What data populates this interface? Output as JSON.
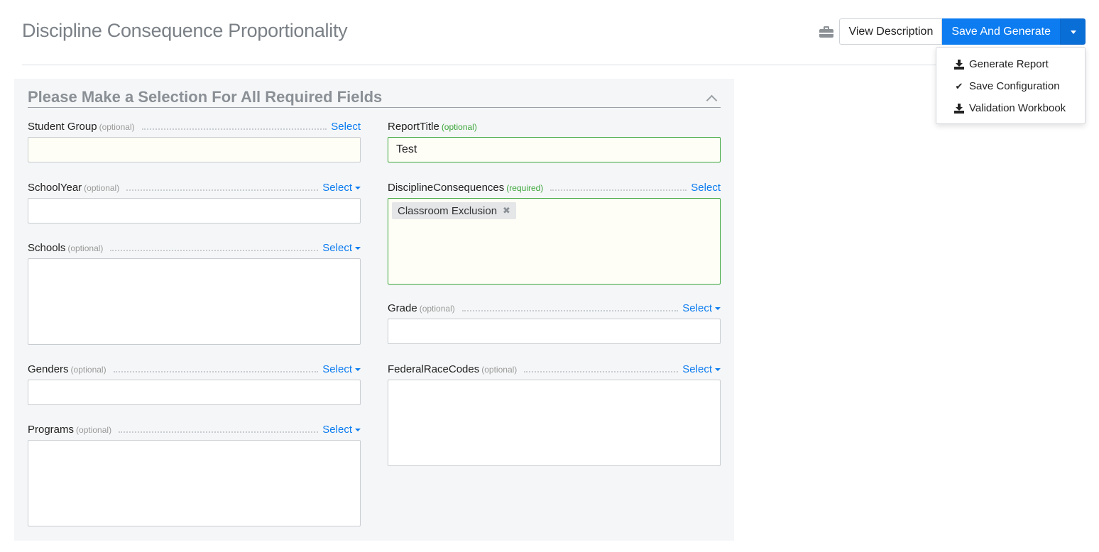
{
  "page": {
    "title": "Discipline Consequence Proportionality"
  },
  "toolbar": {
    "briefcase_icon": "briefcase-icon",
    "view_description_label": "View Description",
    "save_generate_label": "Save And Generate",
    "caret_icon": "caret-down-icon"
  },
  "dropdown": {
    "items": [
      {
        "label": "Generate Report",
        "icon": "download-icon"
      },
      {
        "label": "Save Configuration",
        "icon": "check-icon"
      },
      {
        "label": "Validation Workbook",
        "icon": "download-icon"
      }
    ]
  },
  "panel": {
    "title": "Please Make a Selection For All Required Fields"
  },
  "fields": {
    "student_group": {
      "label": "Student Group",
      "tag": "(optional)",
      "select": "Select",
      "value": ""
    },
    "report_title": {
      "label": "ReportTitle",
      "tag": "(optional)",
      "value": "Test"
    },
    "school_year": {
      "label": "SchoolYear",
      "tag": "(optional)",
      "select": "Select",
      "value": ""
    },
    "discipline_consequences": {
      "label": "DisciplineConsequences",
      "tag": "(required)",
      "select": "Select",
      "chip": "Classroom Exclusion",
      "chip_remove": "✖"
    },
    "schools": {
      "label": "Schools",
      "tag": "(optional)",
      "select": "Select"
    },
    "grade": {
      "label": "Grade",
      "tag": "(optional)",
      "select": "Select"
    },
    "genders": {
      "label": "Genders",
      "tag": "(optional)",
      "select": "Select"
    },
    "federal_race_codes": {
      "label": "FederalRaceCodes",
      "tag": "(optional)",
      "select": "Select"
    },
    "programs": {
      "label": "Programs",
      "tag": "(optional)",
      "select": "Select"
    }
  },
  "colors": {
    "primary": "#0c7cf0",
    "success": "#3aa63a",
    "panel_bg": "#f5f6f7"
  }
}
